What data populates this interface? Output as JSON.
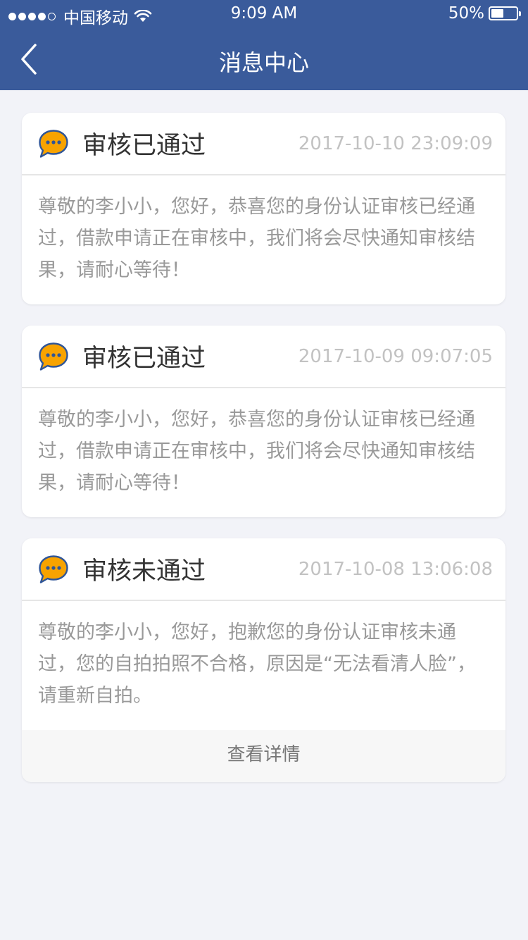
{
  "status_bar": {
    "carrier": "中国移动",
    "time": "9:09 AM",
    "battery_percent": "50%",
    "battery_level": 0.5,
    "signal_bars": 4
  },
  "nav": {
    "title": "消息中心",
    "back_icon": "chevron-left-icon"
  },
  "colors": {
    "header_bg": "#3a5b9b",
    "icon_orange": "#f8a300",
    "icon_blue": "#2f5597",
    "page_bg": "#f2f3f8"
  },
  "messages": [
    {
      "title": "审核已通过",
      "time": "2017-10-10 23:09:09",
      "body": "尊敬的李小小，您好，恭喜您的身份认证审核已经通过，借款申请正在审核中，我们将会尽快通知审核结果，请耐心等待！",
      "icon": "chat-bubble-icon"
    },
    {
      "title": "审核已通过",
      "time": "2017-10-09 09:07:05",
      "body": "尊敬的李小小，您好，恭喜您的身份认证审核已经通过，借款申请正在审核中，我们将会尽快通知审核结果，请耐心等待！",
      "icon": "chat-bubble-icon"
    },
    {
      "title": "审核未通过",
      "time": "2017-10-08 13:06:08",
      "body": "尊敬的李小小，您好，抱歉您的身份认证审核未通过，您的自拍拍照不合格，原因是“无法看清人脸”，请重新自拍。",
      "icon": "chat-bubble-icon",
      "action_label": "查看详情"
    }
  ]
}
